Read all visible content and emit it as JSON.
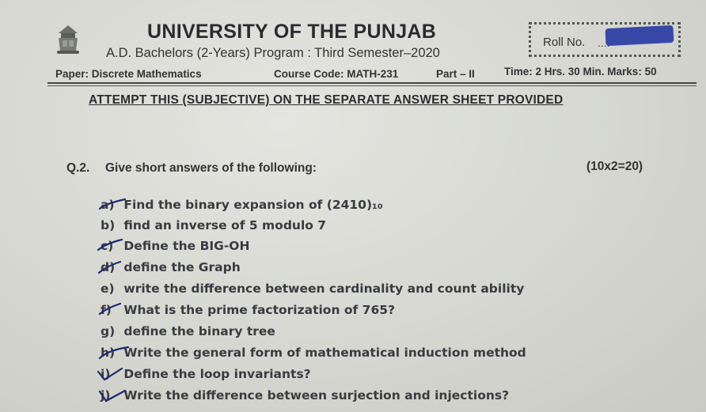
{
  "header": {
    "university": "UNIVERSITY OF THE PUNJAB",
    "program": "A.D. Bachelors (2-Years) Program : Third Semester–2020",
    "roll_label": "Roll No.",
    "roll_dots": "...."
  },
  "meta": {
    "paper": "Paper: Discrete Mathematics",
    "course_code": "Course Code: MATH-231",
    "part": "Part – II",
    "time_marks": "Time: 2 Hrs. 30 Min.  Marks: 50"
  },
  "instruction": "ATTEMPT THIS (SUBJECTIVE) ON THE SEPARATE ANSWER SHEET PROVIDED",
  "question": {
    "number": "Q.2.",
    "text": "Give short answers of the following:",
    "marks": "(10x2=20)",
    "items": [
      {
        "label": "a)",
        "text": "Find the binary expansion of (2410)₁₀"
      },
      {
        "label": "b)",
        "text": "find an inverse of 5 modulo 7"
      },
      {
        "label": "c)",
        "text": "Define the BIG-OH"
      },
      {
        "label": "d)",
        "text": "define the Graph"
      },
      {
        "label": "e)",
        "text": "write the difference between cardinality and count ability"
      },
      {
        "label": "f)",
        "text": "What is the prime factorization of 765?"
      },
      {
        "label": "g)",
        "text": "define the binary tree"
      },
      {
        "label": "h)",
        "text": "Write the general form of mathematical induction method"
      },
      {
        "label": "i)",
        "text": "Define the loop invariants?"
      },
      {
        "label": "j)",
        "text": "Write the difference between surjection and injections?"
      }
    ]
  },
  "colors": {
    "paper": "#d6d7d1",
    "ink": "#2a2a2c",
    "pen_marks": "#1e2a72",
    "redaction": "#3848a8"
  }
}
